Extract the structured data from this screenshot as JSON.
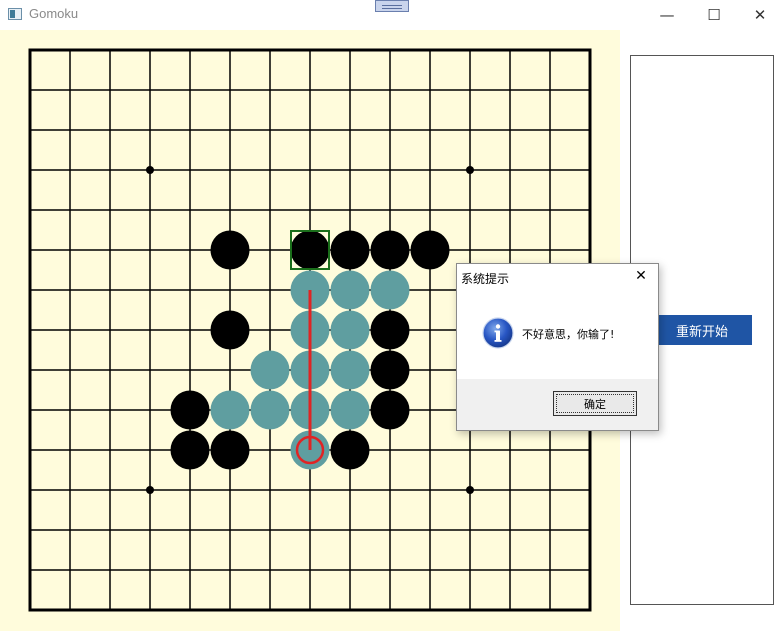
{
  "window": {
    "title": "Gomoku",
    "minimize_glyph": "—",
    "maximize_glyph": "☐",
    "close_glyph": "✕"
  },
  "board": {
    "size": 15,
    "star_points": [
      [
        3,
        3
      ],
      [
        11,
        3
      ],
      [
        3,
        11
      ],
      [
        11,
        11
      ]
    ],
    "colors": {
      "background": "#fffcdc",
      "grid": "#000000",
      "black": "#000000",
      "white": "#5f9ea0",
      "win_line": "#e02424",
      "last_move": "#1a6e1a"
    },
    "black_stones": [
      [
        5,
        5
      ],
      [
        7,
        5
      ],
      [
        8,
        5
      ],
      [
        9,
        5
      ],
      [
        10,
        5
      ],
      [
        9,
        7
      ],
      [
        5,
        7
      ],
      [
        9,
        8
      ],
      [
        4,
        9
      ],
      [
        9,
        9
      ],
      [
        4,
        10
      ],
      [
        5,
        10
      ],
      [
        8,
        10
      ]
    ],
    "white_stones": [
      [
        7,
        6
      ],
      [
        8,
        6
      ],
      [
        9,
        6
      ],
      [
        7,
        7
      ],
      [
        8,
        7
      ],
      [
        6,
        8
      ],
      [
        7,
        8
      ],
      [
        8,
        8
      ],
      [
        5,
        9
      ],
      [
        6,
        9
      ],
      [
        7,
        9
      ],
      [
        8,
        9
      ],
      [
        7,
        10
      ]
    ],
    "last_move": [
      7,
      5
    ],
    "win_line": {
      "from": [
        7,
        6
      ],
      "to": [
        7,
        10
      ]
    }
  },
  "side_panel": {
    "restart_label": "重新开始"
  },
  "dialog": {
    "title": "系统提示",
    "close_glyph": "✕",
    "icon": "info-icon",
    "message": "不好意思，你输了!",
    "ok_label": "确定"
  }
}
